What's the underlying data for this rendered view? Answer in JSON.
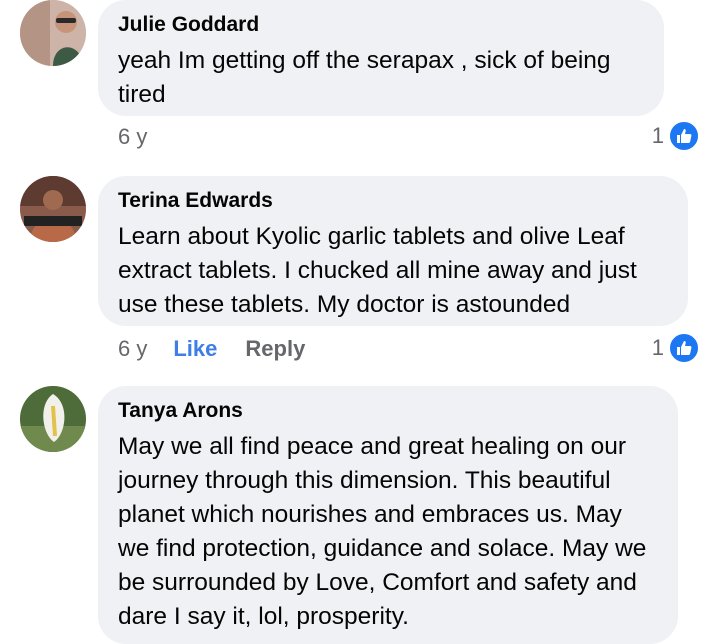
{
  "comments": [
    {
      "author": "Julie Goddard",
      "text": "yeah Im getting off the serapax , sick of being tired",
      "time": "6 y",
      "like": "",
      "reply": "",
      "reactions": "1"
    },
    {
      "author": "Terina Edwards",
      "text": "Learn about Kyolic garlic tablets and olive Leaf extract tablets. I chucked all mine away and just use these tablets. My doctor is astounded",
      "time": "6 y",
      "like": "Like",
      "reply": "Reply",
      "reactions": "1"
    },
    {
      "author": "Tanya Arons",
      "text": "May we all find peace and great healing on our journey through this dimension.  This beautiful planet which nourishes and embraces us.  May we find protection, guidance and solace.  May we be surrounded by Love, Comfort and safety and dare I say it, lol, prosperity."
    }
  ],
  "colors": {
    "like_blue": "#1d77f2",
    "bubble": "#eff1f4",
    "link": "#3e7ee6"
  }
}
